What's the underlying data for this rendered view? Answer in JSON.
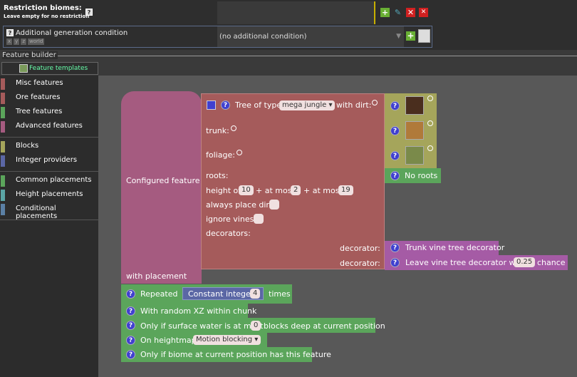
{
  "restriction": {
    "title": "Restriction biomes:",
    "subtitle": "Leave empty for no restriction",
    "help": "?"
  },
  "generation": {
    "label": "Additional generation condition",
    "help": "?",
    "tags": [
      "x",
      "y",
      "z",
      "world"
    ],
    "selected": "(no additional condition)"
  },
  "builder": {
    "label": "Feature builder",
    "templates_button": "Feature templates"
  },
  "palette": {
    "group1": [
      {
        "label": "Misc features",
        "color": "#a55b5b"
      },
      {
        "label": "Ore features",
        "color": "#a55b5b"
      },
      {
        "label": "Tree features",
        "color": "#5ba55b"
      },
      {
        "label": "Advanced features",
        "color": "#a55b80"
      }
    ],
    "group2": [
      {
        "label": "Blocks",
        "color": "#a5a55b"
      },
      {
        "label": "Integer providers",
        "color": "#5b67a5"
      }
    ],
    "group3": [
      {
        "label": "Common placements",
        "color": "#5ba55b"
      },
      {
        "label": "Height placements",
        "color": "#5ba5a5"
      },
      {
        "label": "Conditional placements",
        "color": "#5b80a5"
      }
    ]
  },
  "blocks": {
    "configured_feature": "Configured feature",
    "with_placement": "with placement",
    "tree_prefix": "Tree of type",
    "tree_type": "mega jungle",
    "with_dirt": "with dirt:",
    "trunk": "trunk:",
    "foliage": "foliage:",
    "roots": "roots:",
    "no_roots": "No roots",
    "height_of": "height of",
    "height_base": "10",
    "at_most_1": "+ at most",
    "height_rand_a": "2",
    "at_most_2": "+ at most",
    "height_rand_b": "19",
    "always_place_dirt": "always place dirt:",
    "ignore_vines": "ignore vines:",
    "decorators": "decorators:",
    "decorator_label_1": "decorator:",
    "decorator_1": "Trunk vine tree decorator",
    "decorator_label_2": "decorator:",
    "decorator_2_prefix": "Leave vine tree decorator with",
    "decorator_2_value": "0.25",
    "decorator_2_suffix": "chance",
    "repeated": "Repeated",
    "constant_integer": "Constant integer:",
    "constant_value": "4",
    "times": "times",
    "random_xz": "With random XZ within chunk",
    "surface_water_prefix": "Only if surface water is at most",
    "surface_water_value": "0",
    "surface_water_suffix": "blocks deep at current position",
    "on_heightmap": "On heightmap",
    "heightmap_type": "Motion blocking",
    "biome_check": "Only if biome at current position has this feature"
  }
}
